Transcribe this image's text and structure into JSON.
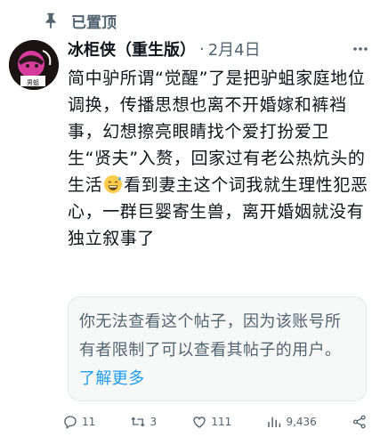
{
  "pinned": {
    "label": "已置顶",
    "icon": "pin-icon"
  },
  "tweet": {
    "author": "冰柜侠（重生版）",
    "separator": "·",
    "date": "2月4日",
    "text_before_emoji": "简中驴所谓“觉醒”了是把驴蛆家庭地位调换，传播思想也离不开婚嫁和裤裆事，幻想擦亮眼睛找个爱打扮爱卫生“贤夫”入赘，回家过有老公热炕头的生活",
    "emoji": "grinning-sweat-emoji",
    "text_after_emoji": "看到妻主这个词我就生理性犯恶心，一群巨婴寄生兽，离开婚姻就没有独立叙事了",
    "avatar_badge": "男蛆"
  },
  "notice": {
    "text": "你无法查看这个帖子，因为该账号所有者限制了可以查看其帖子的用户。",
    "link": "了解更多"
  },
  "actions": {
    "replies": "11",
    "retweets": "3",
    "likes": "111",
    "views": "9,436"
  },
  "colors": {
    "accent": "#1d9bf0",
    "muted": "#536471",
    "text": "#0f1419",
    "card_bg": "#f7f9f9"
  }
}
